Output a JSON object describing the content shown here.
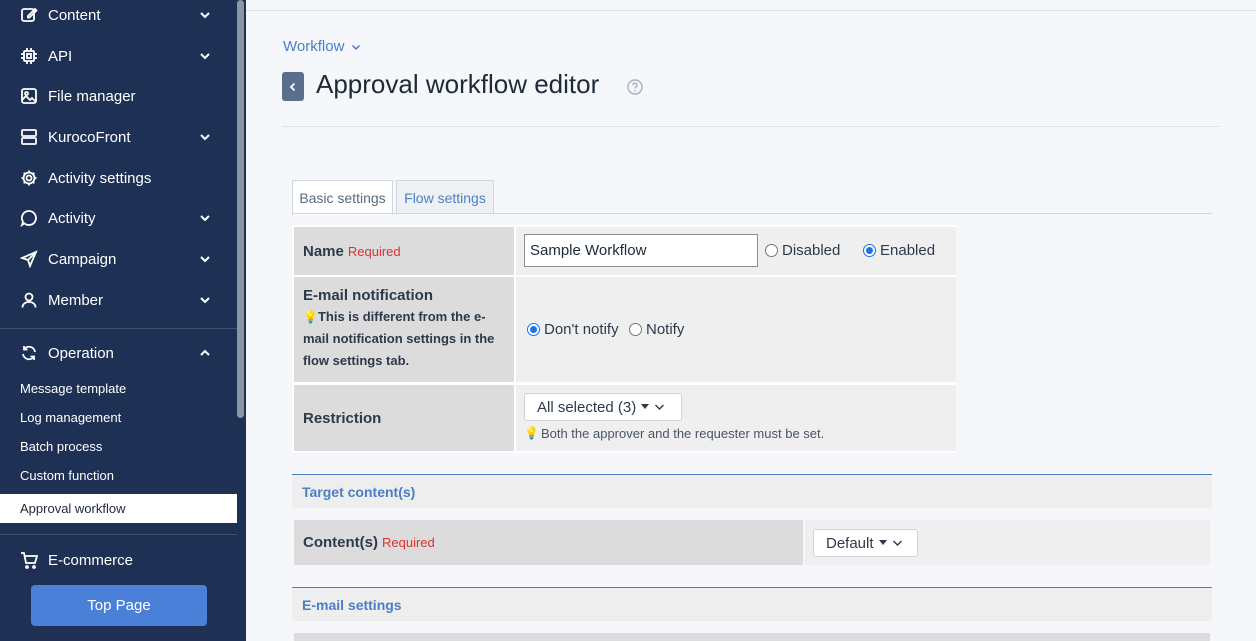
{
  "sidebar": {
    "items": [
      {
        "label": "Content",
        "icon": "edit-icon"
      },
      {
        "label": "API",
        "icon": "chip-icon"
      },
      {
        "label": "File manager",
        "icon": "image-icon"
      },
      {
        "label": "KurocoFront",
        "icon": "server-icon"
      },
      {
        "label": "Activity settings",
        "icon": "gear-icon"
      },
      {
        "label": "Activity",
        "icon": "chat-icon"
      },
      {
        "label": "Campaign",
        "icon": "send-icon"
      },
      {
        "label": "Member",
        "icon": "user-icon"
      },
      {
        "label": "Operation",
        "icon": "refresh-icon"
      },
      {
        "label": "E-commerce",
        "icon": "cart-icon"
      }
    ],
    "sub_items": [
      "Message template",
      "Log management",
      "Batch process",
      "Custom function",
      "Approval workflow"
    ],
    "top_button": "Top Page"
  },
  "breadcrumb": "Workflow",
  "page_title": "Approval workflow editor",
  "tabs": [
    "Basic settings",
    "Flow settings"
  ],
  "form": {
    "name_label": "Name",
    "required": "Required",
    "name_value": "Sample Workflow",
    "disabled_label": "Disabled",
    "enabled_label": "Enabled",
    "email_label": "E-mail notification",
    "email_note": "This is different from the e-mail notification settings in the flow settings tab.",
    "dont_notify": "Don't notify",
    "notify": "Notify",
    "restriction_label": "Restriction",
    "restriction_value": "All selected (3)",
    "restriction_note": "Both the approver and the requester must be set."
  },
  "target_section": {
    "title": "Target content(s)",
    "contents_label": "Content(s)",
    "required": "Required",
    "select_value": "Default"
  },
  "email_section": {
    "title": "E-mail settings"
  },
  "colors": {
    "sidebar_bg": "#1e3155",
    "accent": "#4a80d8",
    "required": "#d9352b",
    "link": "#4a7fc7"
  }
}
